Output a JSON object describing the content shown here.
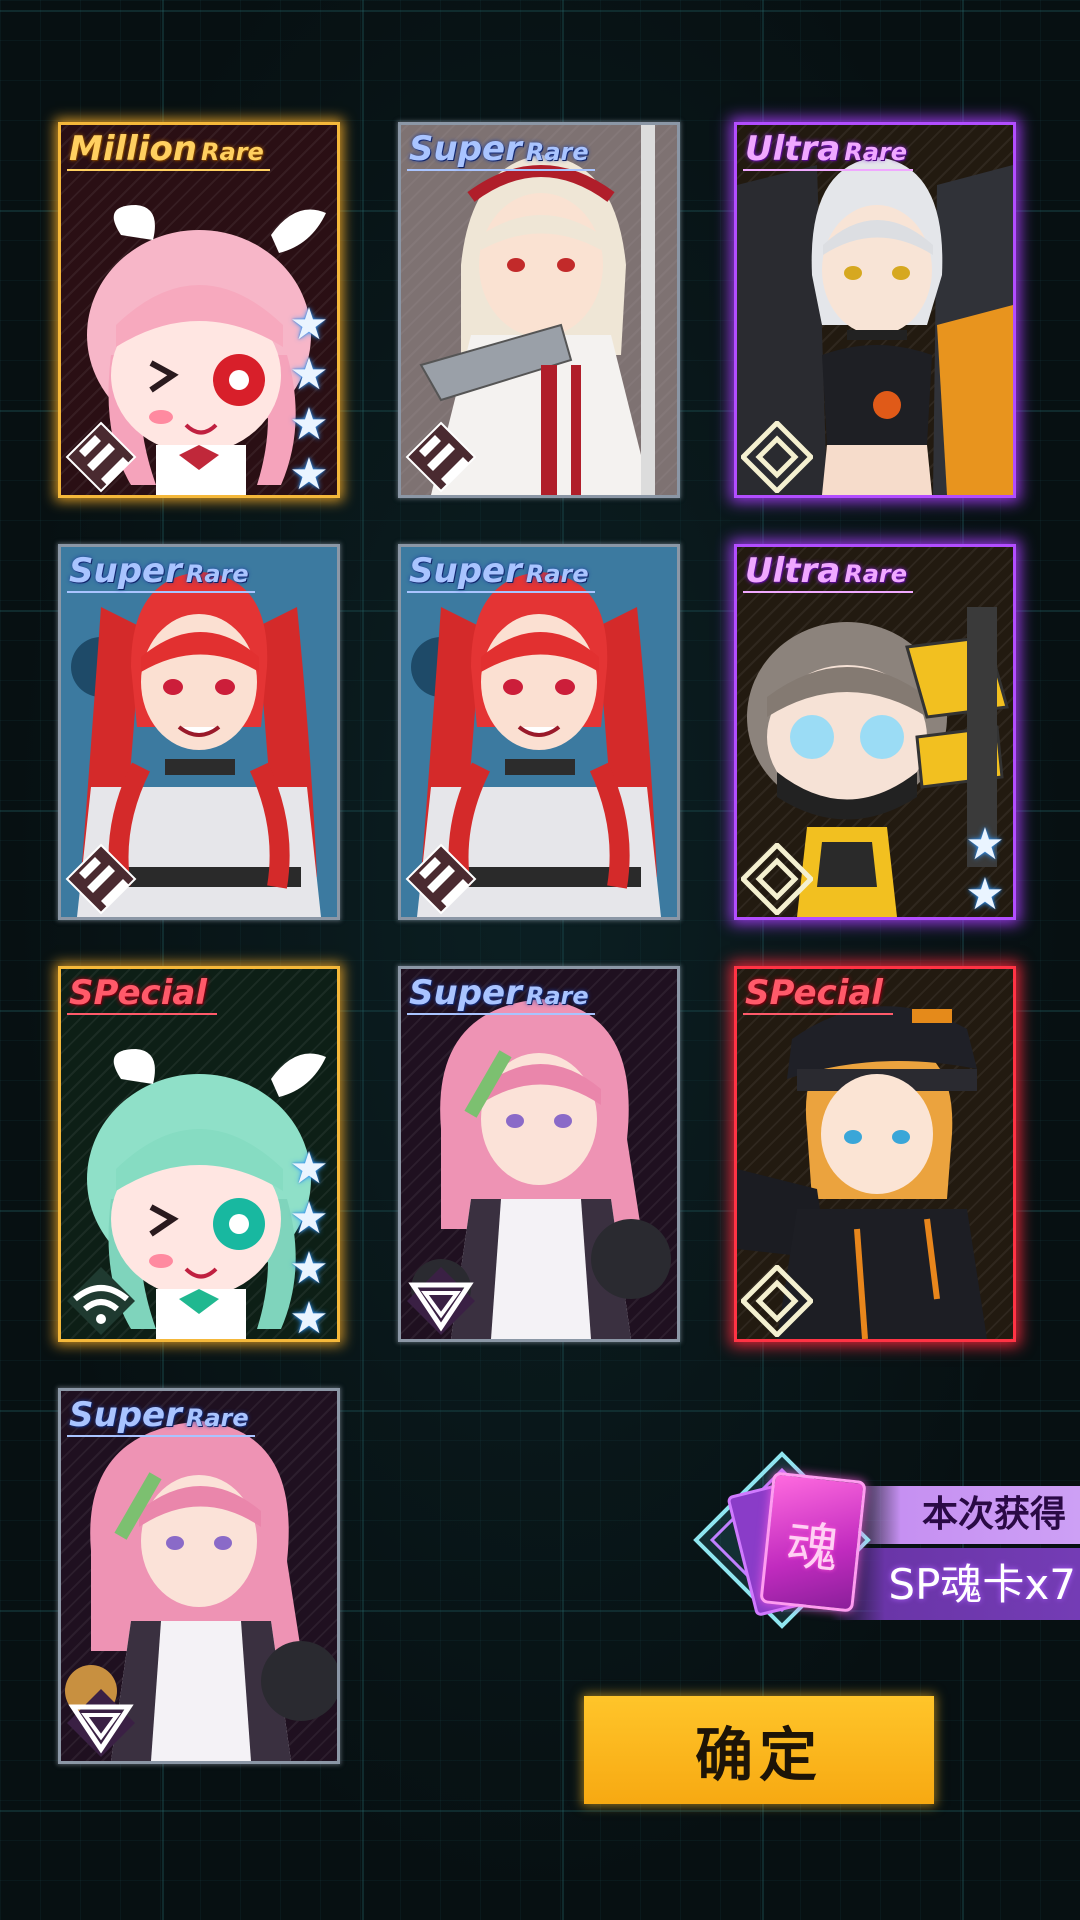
{
  "cards": [
    {
      "rarity_main": "Million",
      "rarity_sub": "Rare",
      "rarity_class": "mr",
      "stars": 4,
      "badge_icon": "stripes-badge-icon",
      "character": "pink-haired chibi girl with angel wings"
    },
    {
      "rarity_main": "Super",
      "rarity_sub": "Rare",
      "rarity_class": "sr",
      "stars": 0,
      "badge_icon": "stripes-badge-icon",
      "character": "blonde knight girl with red headband"
    },
    {
      "rarity_main": "Ultra",
      "rarity_sub": "Rare",
      "rarity_class": "ur",
      "stars": 0,
      "badge_icon": "diamond-badge-icon",
      "character": "silver-haired girl in black crop top"
    },
    {
      "rarity_main": "Super",
      "rarity_sub": "Rare",
      "rarity_class": "sr",
      "stars": 0,
      "badge_icon": "stripes-badge-icon",
      "character": "red twin-tail girl with chain collar"
    },
    {
      "rarity_main": "Super",
      "rarity_sub": "Rare",
      "rarity_class": "sr",
      "stars": 0,
      "badge_icon": "stripes-badge-icon",
      "character": "red twin-tail girl with chain collar"
    },
    {
      "rarity_main": "Ultra",
      "rarity_sub": "Rare",
      "rarity_class": "ur",
      "stars": 2,
      "badge_icon": "diamond-badge-icon",
      "character": "chibi girl with mask and yellow mech"
    },
    {
      "rarity_main": "SPecial",
      "rarity_sub": "",
      "rarity_class": "sp",
      "stars": 4,
      "badge_icon": "wifi-badge-icon",
      "character": "mint-haired chibi girl with angel wings"
    },
    {
      "rarity_main": "Super",
      "rarity_sub": "Rare",
      "rarity_class": "sr",
      "stars": 0,
      "badge_icon": "triangle-badge-icon",
      "character": "pink-haired girl in white suit"
    },
    {
      "rarity_main": "SPecial",
      "rarity_sub": "",
      "rarity_class": "sp",
      "stars": 0,
      "badge_icon": "diamond-badge-icon",
      "character": "blonde girl with black cap and uniform"
    },
    {
      "rarity_main": "Super",
      "rarity_sub": "Rare",
      "rarity_class": "sr",
      "stars": 0,
      "badge_icon": "triangle-badge-icon",
      "character": "pink-haired girl in white suit"
    }
  ],
  "reward": {
    "title": "本次获得",
    "amount": "SP魂卡x7",
    "card_glyph": "魂",
    "icon": "soul-card-icon"
  },
  "confirm": {
    "label": "确定"
  },
  "colors": {
    "mr": "#f5b83a",
    "sr": "#8b97a6",
    "ur": "#b24dff",
    "sp_gold": "#f5b83a",
    "sp_red": "#ff3344",
    "confirm": "#ffbe22",
    "reward_purple": "#743cb5",
    "star": "#eaf4ff"
  }
}
